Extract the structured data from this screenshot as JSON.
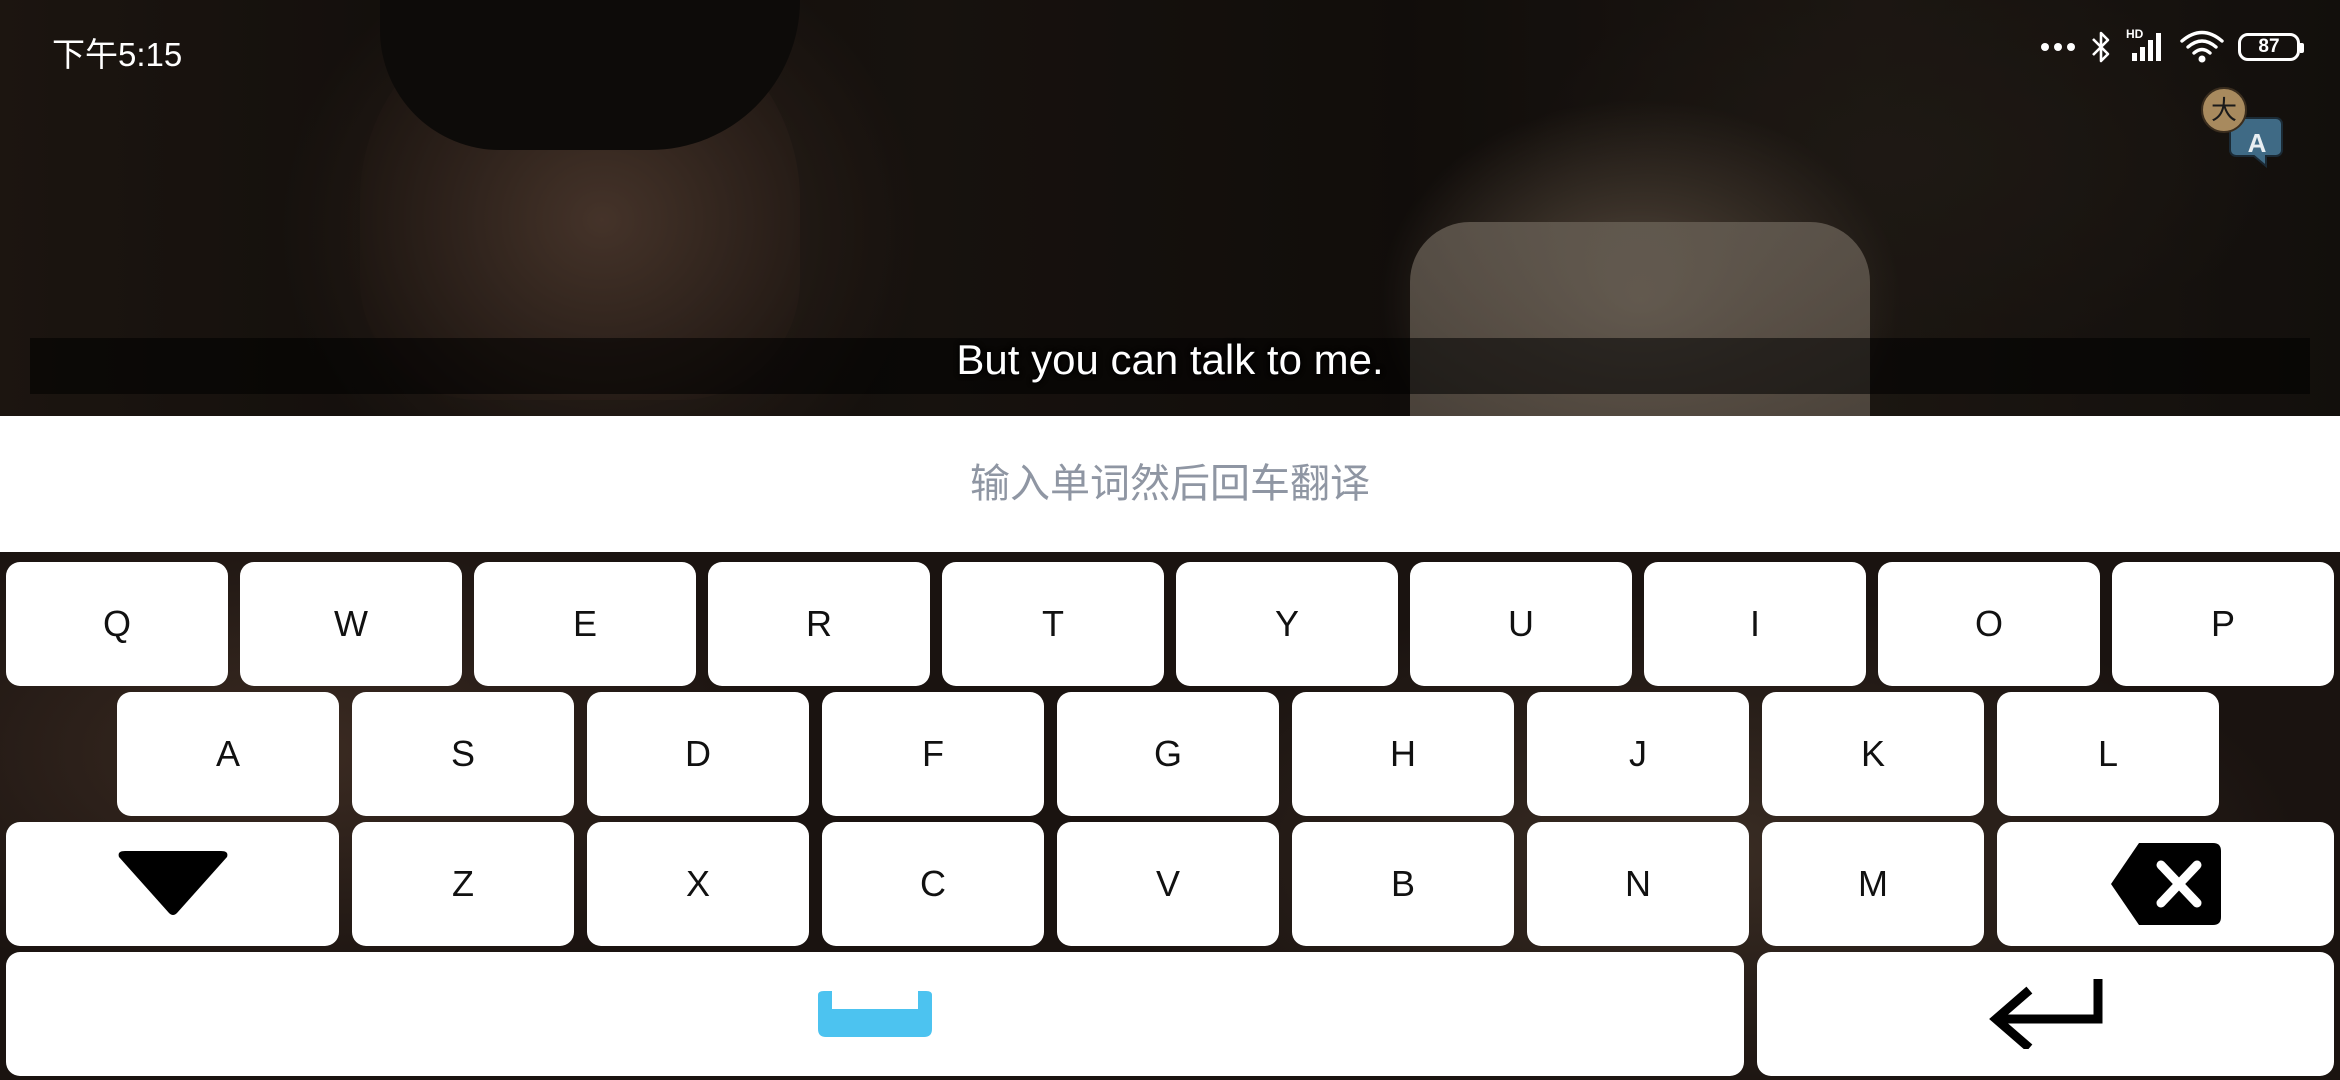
{
  "status_bar": {
    "time": "下午5:15",
    "network_label": "HD",
    "battery": "87"
  },
  "video": {
    "subtitle": "But you can talk to me."
  },
  "translate_button": {
    "icon_char_zh": "大",
    "icon_char_en": "A"
  },
  "input": {
    "placeholder": "输入单词然后回车翻译",
    "value": ""
  },
  "keyboard": {
    "row1": [
      "Q",
      "W",
      "E",
      "R",
      "T",
      "Y",
      "U",
      "I",
      "O",
      "P"
    ],
    "row2": [
      "A",
      "S",
      "D",
      "F",
      "G",
      "H",
      "J",
      "K",
      "L"
    ],
    "row3": [
      "Z",
      "X",
      "C",
      "V",
      "B",
      "N",
      "M"
    ],
    "hide_key_icon": "triangle-down-icon",
    "backspace_icon": "backspace-x-icon",
    "space_icon": "space-bar-icon",
    "enter_icon": "enter-arrow-icon",
    "space_icon_color": "#4cc3f0"
  }
}
